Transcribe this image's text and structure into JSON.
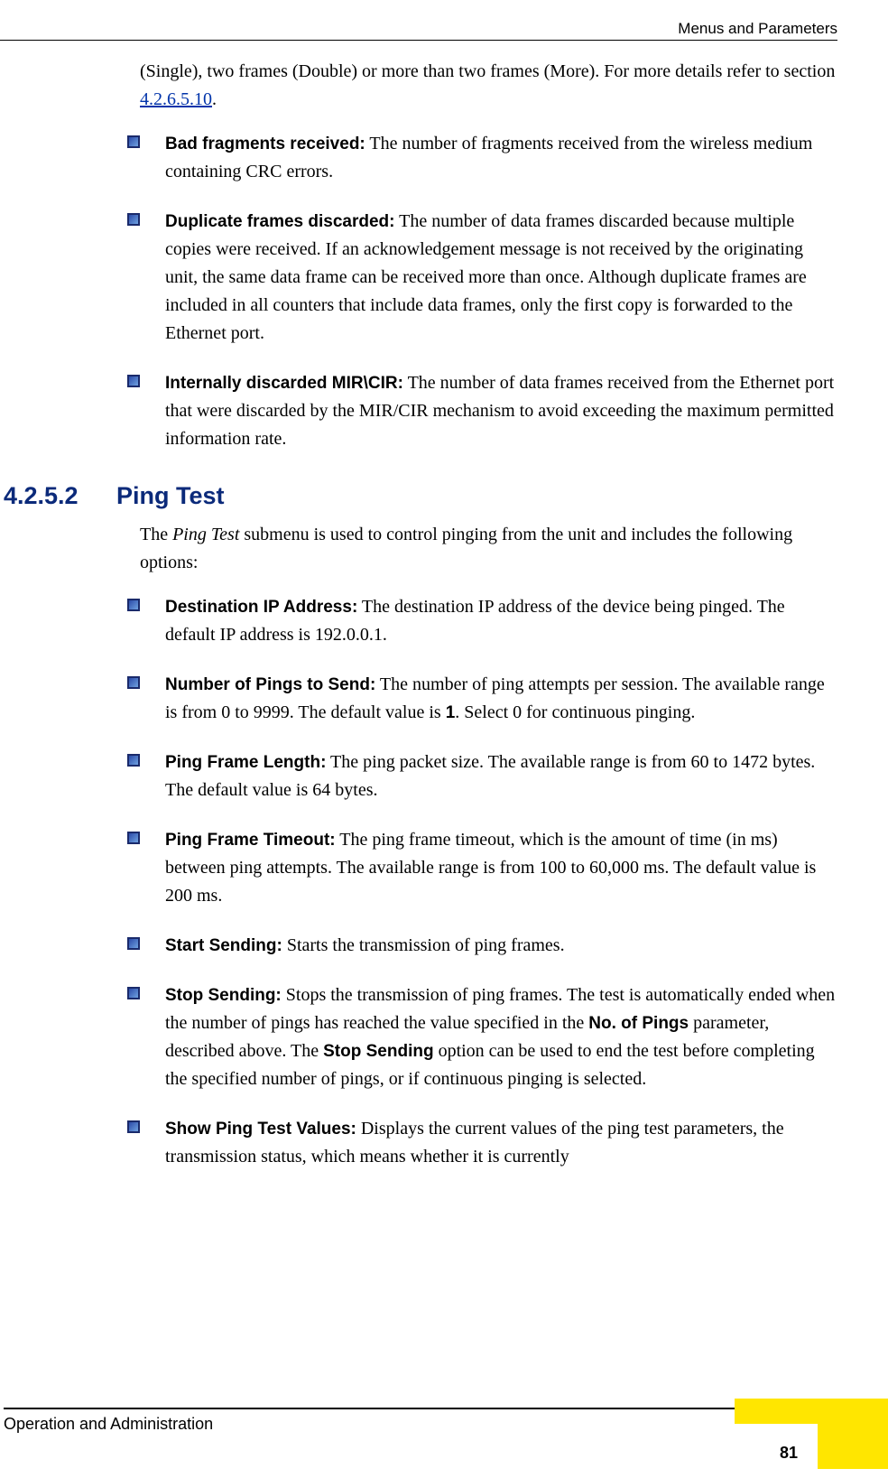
{
  "header": {
    "running_head": "Menus and Parameters"
  },
  "intro_para_pre": "(Single), two frames (Double) or more than two frames (More). For more details refer to section ",
  "intro_link": "4.2.6.5.10",
  "intro_para_post": ".",
  "list_a": [
    {
      "term": "Bad fragments received:",
      "body": " The number of fragments received from the wireless medium containing CRC errors."
    },
    {
      "term": "Duplicate frames discarded:",
      "body": " The number of data frames discarded because multiple copies were received. If an acknowledgement message is not received by the originating unit, the same data frame can be received more than once. Although duplicate frames are included in all counters that include data frames, only the first copy is forwarded to the Ethernet port."
    },
    {
      "term": "Internally discarded MIR\\CIR:",
      "body": " The number of data frames received from the Ethernet port that were discarded by the MIR/CIR mechanism to avoid exceeding the maximum permitted information rate."
    }
  ],
  "section": {
    "num": "4.2.5.2",
    "title": "Ping Test"
  },
  "ping_intro_pre": "The ",
  "ping_intro_em": "Ping Test",
  "ping_intro_post": " submenu is used to control pinging from the unit and includes the following options:",
  "list_b": [
    {
      "term": "Destination IP Address:",
      "body": " The destination IP address of the device being pinged. The default IP address is 192.0.0.1."
    },
    {
      "term": "Number of Pings to Send:",
      "body_pre": " The number of ping attempts per session. The available range is from 0 to 9999. The default value is ",
      "bold1": "1",
      "body_post": ". Select 0 for continuous pinging."
    },
    {
      "term": "Ping Frame Length:",
      "body": " The ping packet size. The available range is from 60 to 1472 bytes. The default value is 64 bytes."
    },
    {
      "term": "Ping Frame Timeout:",
      "body": " The ping frame timeout, which is the amount of time (in ms) between ping attempts. The available range is from 100 to 60,000 ms. The default value is 200 ms."
    },
    {
      "term": "Start Sending:",
      "body": " Starts the transmission of ping frames."
    },
    {
      "term": "Stop Sending:",
      "body_pre": " Stops the transmission of ping frames. The test is automatically ended when the number of pings has reached the value specified in the ",
      "bold1": "No. of Pings",
      "body_mid": " parameter, described above. The ",
      "bold2": "Stop Sending",
      "body_post": " option can be used to end the test before completing the specified number of pings, or if continuous pinging is selected."
    },
    {
      "term": "Show Ping Test Values:",
      "body": " Displays the current values of the ping test parameters, the transmission status, which means whether it is currently"
    }
  ],
  "footer": {
    "text": "Operation and Administration",
    "page": "81"
  }
}
